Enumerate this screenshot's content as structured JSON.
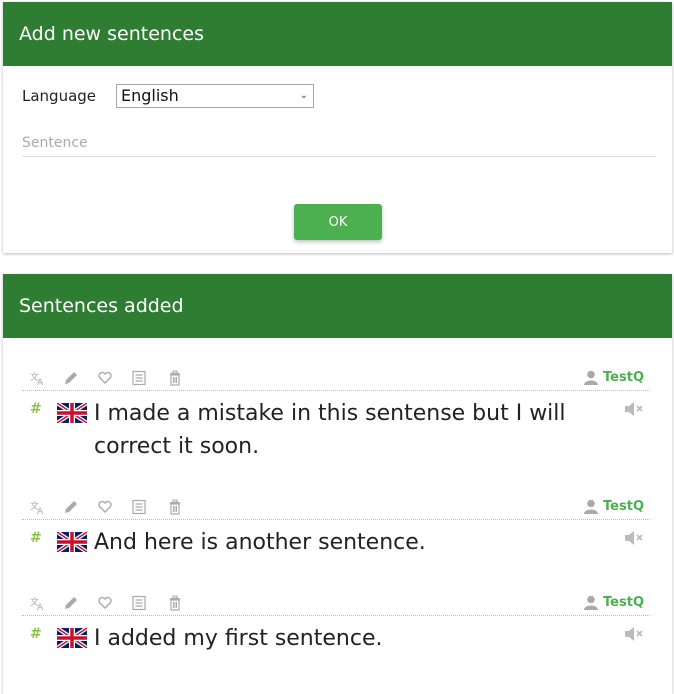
{
  "add_panel": {
    "title": "Add new sentences",
    "language_label": "Language",
    "language_selected": "English",
    "sentence_placeholder": "Sentence",
    "sentence_value": "",
    "ok_label": "OK"
  },
  "added_panel": {
    "title": "Sentences added",
    "sentences": [
      {
        "text": "I made a mistake in this sentense but I will correct it soon.",
        "owner": "TestQ",
        "language": "English",
        "flag": "uk-flag"
      },
      {
        "text": "And here is another sentence.",
        "owner": "TestQ",
        "language": "English",
        "flag": "uk-flag"
      },
      {
        "text": "I added my first sentence.",
        "owner": "TestQ",
        "language": "English",
        "flag": "uk-flag"
      }
    ],
    "tool_icons": [
      "translate-icon",
      "edit-icon",
      "favorite-icon",
      "list-icon",
      "delete-icon"
    ]
  },
  "colors": {
    "header": "#2e7d32",
    "button": "#4caf50",
    "owner": "#4caf50",
    "hash": "#8bc34a"
  }
}
